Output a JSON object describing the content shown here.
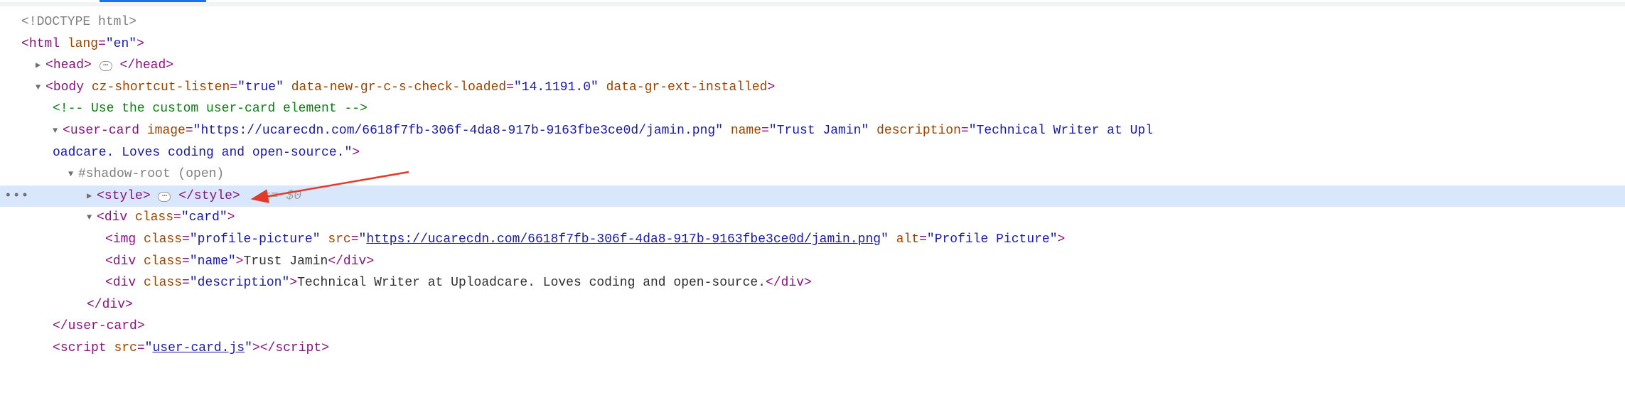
{
  "toggles": {
    "right": "▶",
    "down": "▼"
  },
  "doctype": "<!DOCTYPE html>",
  "html_open": {
    "tag": "html",
    "attr_name": "lang",
    "attr_value": "\"en\""
  },
  "head": {
    "tag": "head"
  },
  "body_open": {
    "tag": "body",
    "attrs": [
      {
        "name": "cz-shortcut-listen",
        "value": "\"true\""
      },
      {
        "name": "data-new-gr-c-s-check-loaded",
        "value": "\"14.1191.0\""
      },
      {
        "name": "data-gr-ext-installed",
        "value": ""
      }
    ]
  },
  "comment_line": "<!-- Use the custom user-card element -->",
  "user_card": {
    "tag": "user-card",
    "attrs": [
      {
        "name": "image",
        "value": "\"https://ucarecdn.com/6618f7fb-306f-4da8-917b-9163fbe3ce0d/jamin.png\""
      },
      {
        "name": "name",
        "value": "\"Trust Jamin\""
      },
      {
        "name": "description",
        "value": "\"Technical Writer at Upl"
      }
    ],
    "wrap_tail": "oadcare. Loves coding and open-source.\"",
    "close_tag": "user-card"
  },
  "shadow_root": "#shadow-root (open)",
  "style_line": {
    "tag": "style",
    "selector_hint": "== $0"
  },
  "card_div": {
    "tag": "div",
    "class_attr": "class",
    "class_val": "\"card\""
  },
  "img_line": {
    "tag": "img",
    "class_attr": "class",
    "class_val": "\"profile-picture\"",
    "src_attr": "src",
    "src_val": "https://ucarecdn.com/6618f7fb-306f-4da8-917b-9163fbe3ce0d/jamin.png",
    "alt_attr": "alt",
    "alt_val": "\"Profile Picture\""
  },
  "name_div": {
    "tag": "div",
    "class_attr": "class",
    "class_val": "\"name\"",
    "text": "Trust Jamin"
  },
  "desc_div": {
    "tag": "div",
    "class_attr": "class",
    "class_val": "\"description\"",
    "text": "Technical Writer at Uploadcare. Loves coding and open-source."
  },
  "div_close": "div",
  "script_line": {
    "tag": "script",
    "src_attr": "src",
    "src_val": "user-card.js"
  },
  "gutter_dots": "•••",
  "collapse_glyph": "⋯"
}
